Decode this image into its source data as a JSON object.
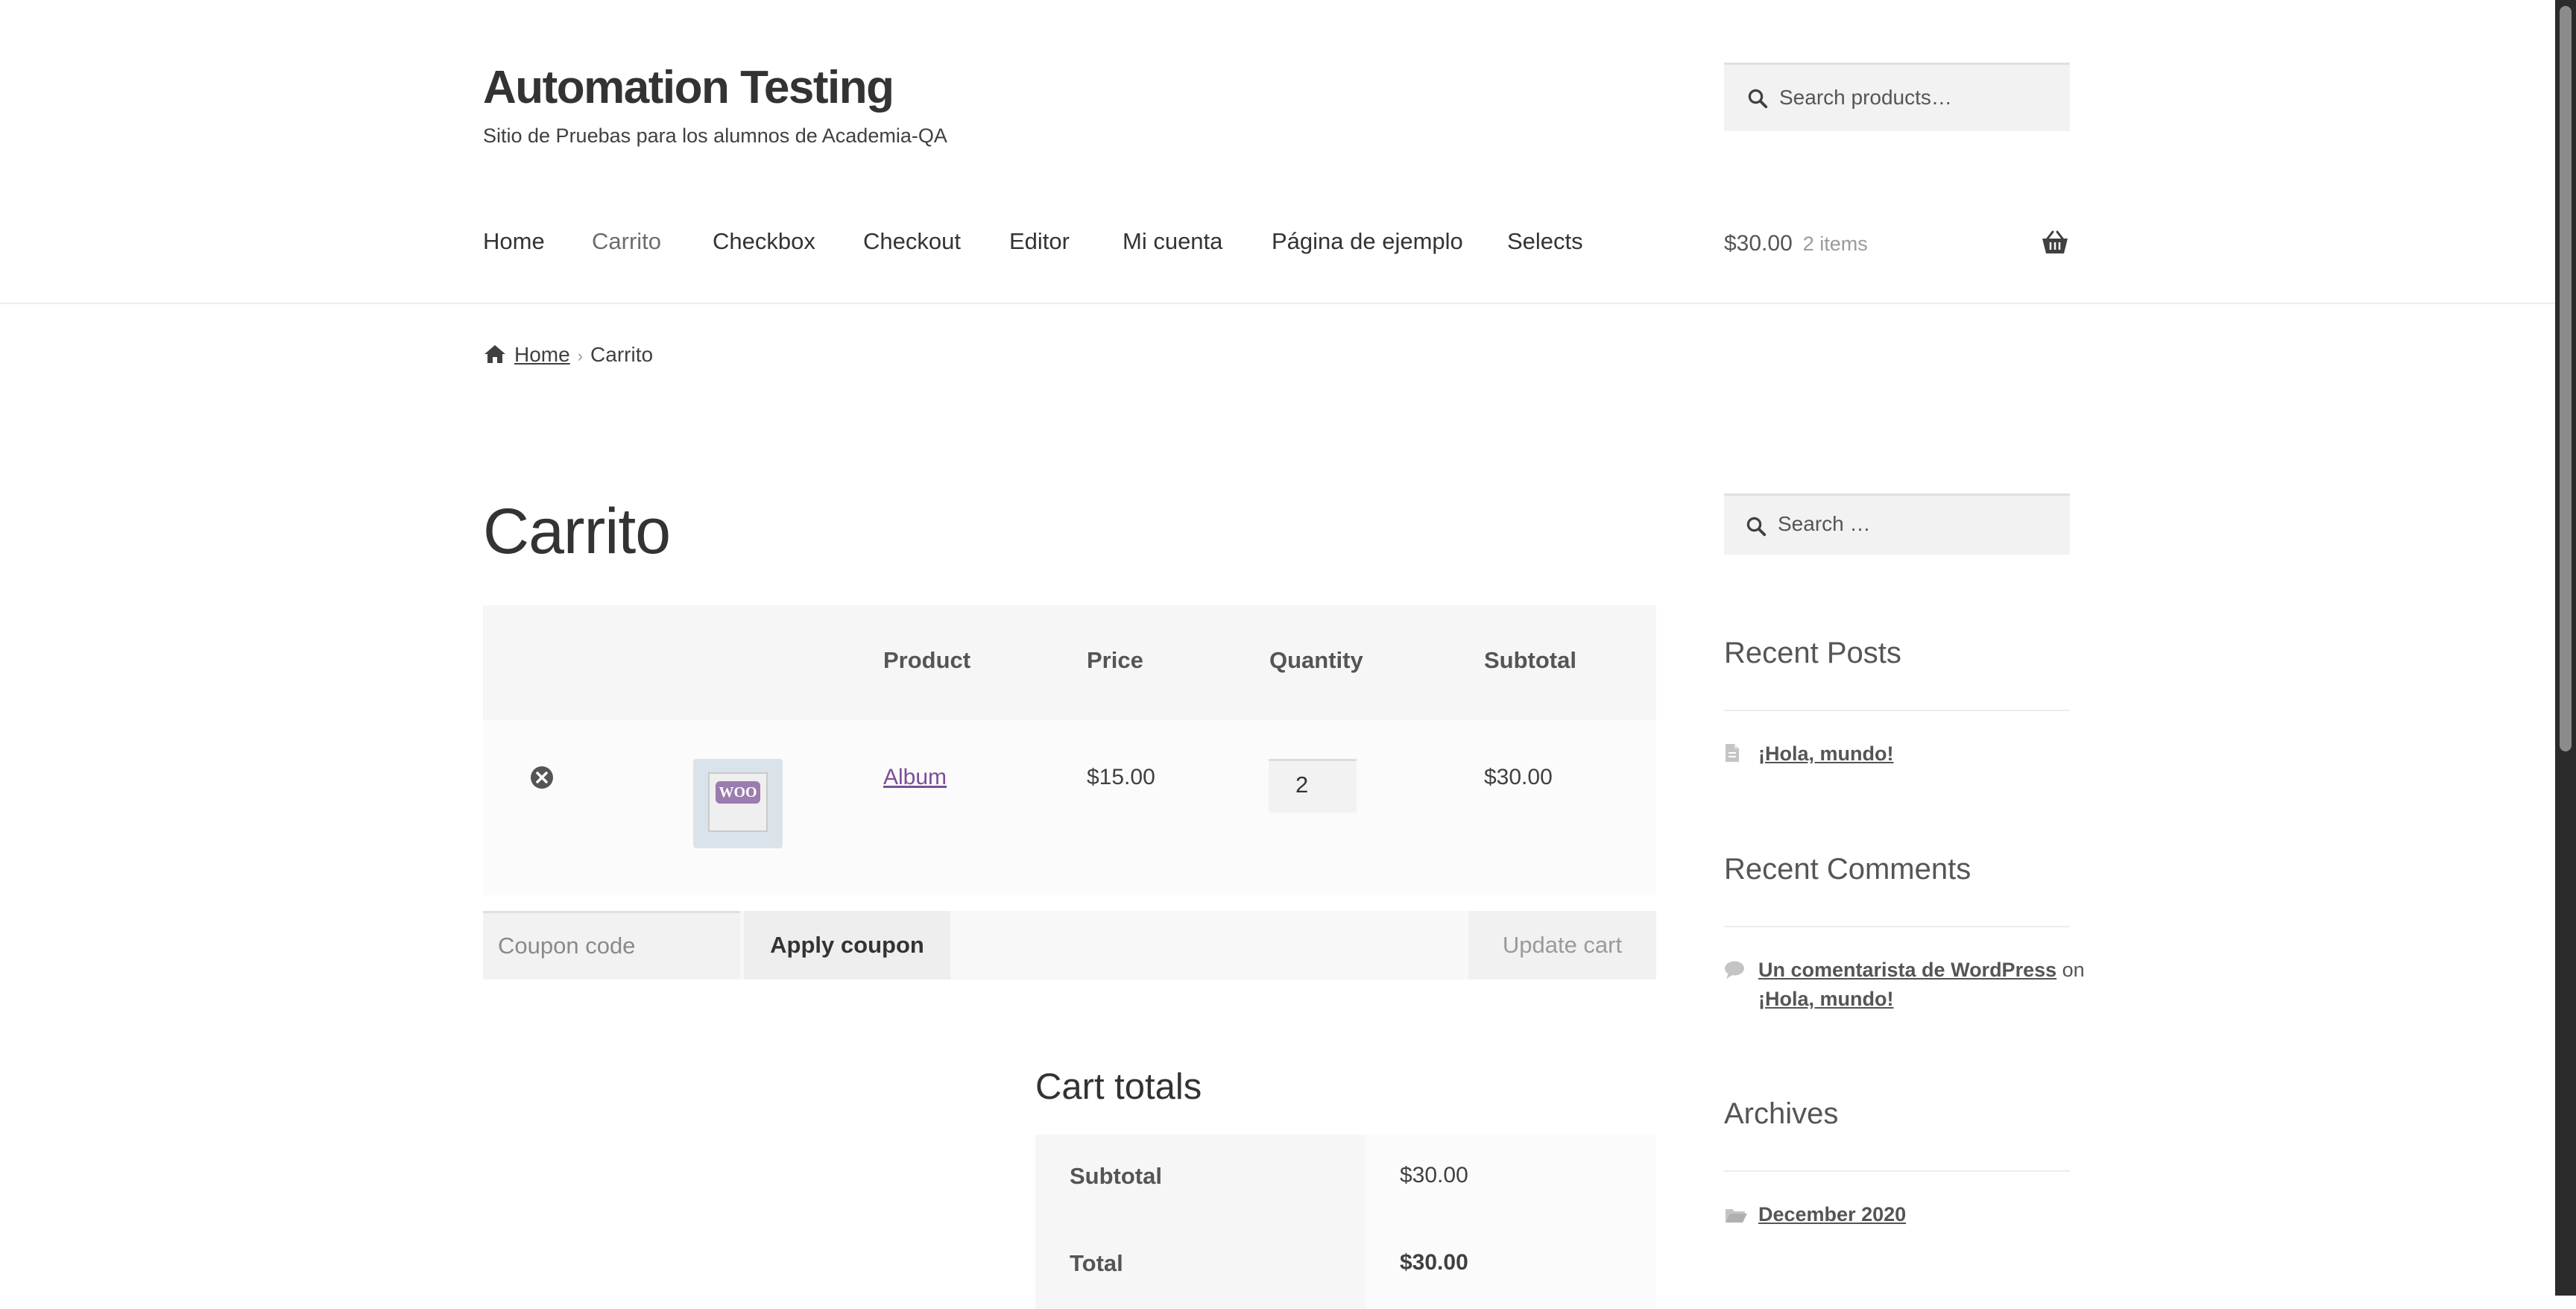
{
  "site": {
    "title": "Automation Testing",
    "tagline": "Sitio de Pruebas para los alumnos de Academia-QA"
  },
  "header_search": {
    "placeholder": "Search products…",
    "icon": "search-icon"
  },
  "nav": {
    "items": [
      "Home",
      "Carrito",
      "Checkbox",
      "Checkout",
      "Editor",
      "Mi cuenta",
      "Página de ejemplo",
      "Selects"
    ],
    "current": "Carrito"
  },
  "mini_cart": {
    "amount": "$30.00",
    "count": "2 items",
    "icon": "basket-icon"
  },
  "breadcrumb": {
    "home": "Home",
    "current": "Carrito"
  },
  "page_title": "Carrito",
  "cart_table": {
    "headers": [
      "Product",
      "Price",
      "Quantity",
      "Subtotal"
    ],
    "rows": [
      {
        "product": "Album",
        "price": "$15.00",
        "quantity": "2",
        "subtotal": "$30.00",
        "thumb_text": "WOO"
      }
    ]
  },
  "actions": {
    "coupon_placeholder": "Coupon code",
    "apply_label": "Apply coupon",
    "update_label": "Update cart"
  },
  "cart_totals": {
    "title": "Cart totals",
    "subtotal_label": "Subtotal",
    "subtotal_value": "$30.00",
    "total_label": "Total",
    "total_value": "$30.00"
  },
  "sidebar": {
    "search_placeholder": "Search …",
    "recent_posts": {
      "title": "Recent Posts",
      "items": [
        "¡Hola, mundo!"
      ]
    },
    "recent_comments": {
      "title": "Recent Comments",
      "author": "Un comentarista de WordPress",
      "joiner": "on",
      "post": "¡Hola, mundo!"
    },
    "archives": {
      "title": "Archives",
      "items": [
        "December 2020"
      ]
    }
  },
  "colors": {
    "link_purple": "#7b4f96",
    "text": "#404040",
    "table_head": "#f6f6f6"
  }
}
